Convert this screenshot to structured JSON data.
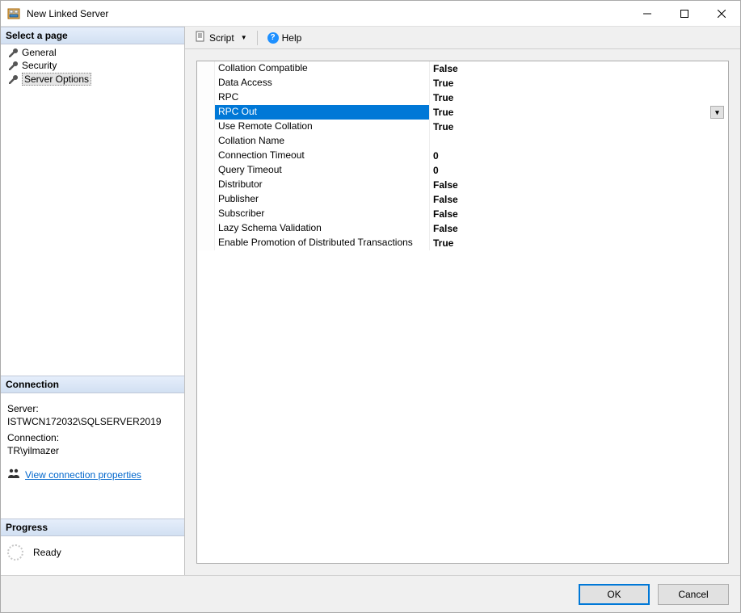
{
  "window": {
    "title": "New Linked Server"
  },
  "sidebar": {
    "select_page_header": "Select a page",
    "pages": [
      {
        "label": "General"
      },
      {
        "label": "Security"
      },
      {
        "label": "Server Options"
      }
    ],
    "selected_index": 2,
    "connection_header": "Connection",
    "server_label": "Server:",
    "server_value": "ISTWCN172032\\SQLSERVER2019",
    "conn_label": "Connection:",
    "conn_value": "TR\\yilmazer",
    "view_props_link": "View connection properties",
    "progress_header": "Progress",
    "progress_status": "Ready"
  },
  "toolbar": {
    "script_label": "Script",
    "help_label": "Help"
  },
  "properties": [
    {
      "name": "Collation Compatible",
      "value": "False"
    },
    {
      "name": "Data Access",
      "value": "True"
    },
    {
      "name": "RPC",
      "value": "True"
    },
    {
      "name": "RPC Out",
      "value": "True",
      "selected": true,
      "dropdown": true
    },
    {
      "name": "Use Remote Collation",
      "value": "True"
    },
    {
      "name": "Collation Name",
      "value": ""
    },
    {
      "name": "Connection Timeout",
      "value": "0"
    },
    {
      "name": "Query Timeout",
      "value": "0"
    },
    {
      "name": "Distributor",
      "value": "False"
    },
    {
      "name": "Publisher",
      "value": "False"
    },
    {
      "name": "Subscriber",
      "value": "False"
    },
    {
      "name": "Lazy Schema Validation",
      "value": "False"
    },
    {
      "name": "Enable Promotion of Distributed Transactions",
      "value": "True"
    }
  ],
  "footer": {
    "ok": "OK",
    "cancel": "Cancel"
  }
}
